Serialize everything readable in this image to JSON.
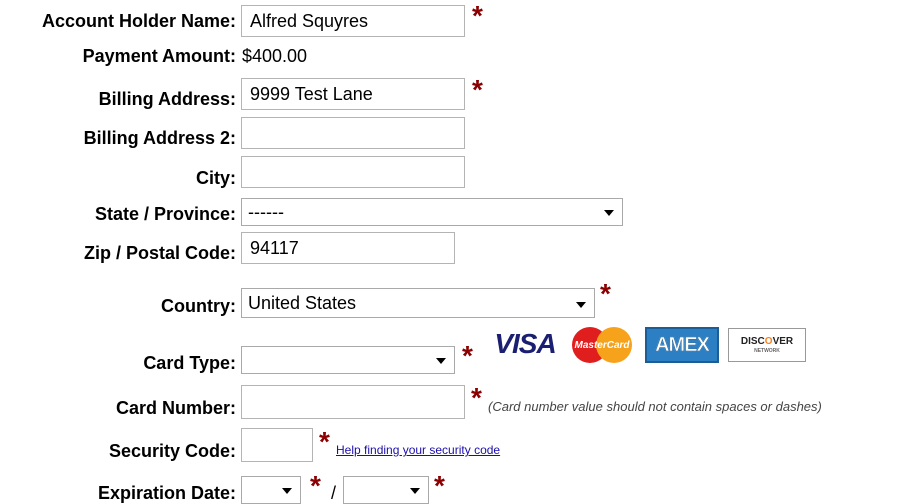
{
  "form": {
    "account_holder": {
      "label": "Account Holder Name:",
      "value": "Alfred Squyres"
    },
    "payment_amount": {
      "label": "Payment Amount:",
      "value": "$400.00"
    },
    "billing_address": {
      "label": "Billing Address:",
      "value": "9999 Test Lane"
    },
    "billing_address_2": {
      "label": "Billing Address 2:",
      "value": ""
    },
    "city": {
      "label": "City:",
      "value": ""
    },
    "state": {
      "label": "State / Province:",
      "selected": "------"
    },
    "zip": {
      "label": "Zip / Postal Code:",
      "value": "94117"
    },
    "country": {
      "label": "Country:",
      "selected": "United States"
    },
    "card_type": {
      "label": "Card Type:",
      "selected": ""
    },
    "card_number": {
      "label": "Card Number:",
      "value": "",
      "note": "(Card number value should not contain spaces or dashes)"
    },
    "security_code": {
      "label": "Security Code:",
      "value": "",
      "help_link": "Help finding your security code"
    },
    "expiration": {
      "label": "Expiration Date:",
      "month": "",
      "separator": "/",
      "year": ""
    },
    "required_marker": "*"
  },
  "card_logos": {
    "visa": "VISA",
    "mastercard": "MasterCard",
    "amex": "AMEX",
    "discover_pre": "DISC",
    "discover_dot": "O",
    "discover_post": "VER",
    "discover_sub": "NETWORK"
  },
  "colors": {
    "required": "#8b0000",
    "link": "#1a0dab",
    "field_border": "#b4b4b4"
  }
}
